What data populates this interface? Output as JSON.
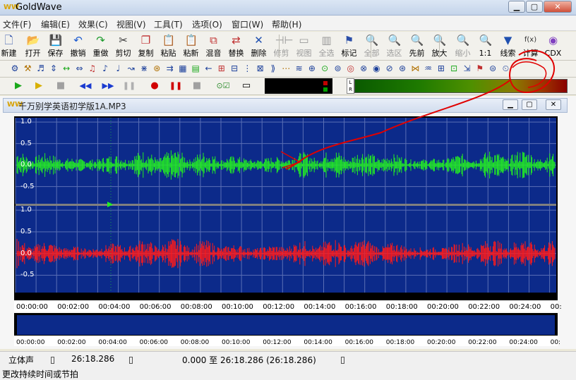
{
  "window": {
    "title": "GoldWave",
    "app_icon": "WW"
  },
  "menu": [
    "文件(F)",
    "编辑(E)",
    "效果(C)",
    "视图(V)",
    "工具(T)",
    "选项(O)",
    "窗口(W)",
    "帮助(H)"
  ],
  "toolbar1": [
    {
      "label": "新建",
      "icon": "new-file-icon",
      "glyph": "🗋",
      "color": "#2a4ea8",
      "enabled": true
    },
    {
      "label": "打开",
      "icon": "open-folder-icon",
      "glyph": "📂",
      "color": "#d9a000",
      "enabled": true
    },
    {
      "label": "保存",
      "icon": "save-icon",
      "glyph": "💾",
      "color": "#2050b0",
      "enabled": true
    },
    {
      "label": "撤销",
      "icon": "undo-icon",
      "glyph": "↶",
      "color": "#1a5ad0",
      "enabled": true
    },
    {
      "label": "重做",
      "icon": "redo-icon",
      "glyph": "↷",
      "color": "#1a9a2a",
      "enabled": true
    },
    {
      "label": "剪切",
      "icon": "cut-icon",
      "glyph": "✂",
      "color": "#333333",
      "enabled": true
    },
    {
      "label": "复制",
      "icon": "copy-icon",
      "glyph": "❐",
      "color": "#c03030",
      "enabled": true
    },
    {
      "label": "粘贴",
      "icon": "paste-icon",
      "glyph": "📋",
      "color": "#b07020",
      "enabled": true
    },
    {
      "label": "粘新",
      "icon": "paste-new-icon",
      "glyph": "📋",
      "color": "#b07020",
      "enabled": true
    },
    {
      "label": "混音",
      "icon": "mix-icon",
      "glyph": "⧉",
      "color": "#c03030",
      "enabled": true
    },
    {
      "label": "替换",
      "icon": "replace-icon",
      "glyph": "⇄",
      "color": "#c03030",
      "enabled": true
    },
    {
      "label": "删除",
      "icon": "delete-icon",
      "glyph": "✕",
      "color": "#2050b0",
      "enabled": true
    },
    {
      "label": "修剪",
      "icon": "trim-icon",
      "glyph": "⊣⊢",
      "color": "#999999",
      "enabled": false
    },
    {
      "label": "视图",
      "icon": "view-icon",
      "glyph": "▭",
      "color": "#999999",
      "enabled": false
    },
    {
      "label": "全选",
      "icon": "select-all-icon",
      "glyph": "▥",
      "color": "#999999",
      "enabled": false
    },
    {
      "label": "标记",
      "icon": "marker-icon",
      "glyph": "⚑",
      "color": "#2a4ea8",
      "enabled": true
    },
    {
      "label": "全部",
      "icon": "zoom-all-icon",
      "glyph": "🔍",
      "color": "#999999",
      "enabled": false
    },
    {
      "label": "选区",
      "icon": "zoom-selection-icon",
      "glyph": "🔍",
      "color": "#999999",
      "enabled": false
    },
    {
      "label": "先前",
      "icon": "zoom-previous-icon",
      "glyph": "🔍",
      "color": "#333333",
      "enabled": true
    },
    {
      "label": "放大",
      "icon": "zoom-in-icon",
      "glyph": "🔍",
      "color": "#333333",
      "enabled": true
    },
    {
      "label": "缩小",
      "icon": "zoom-out-icon",
      "glyph": "🔍",
      "color": "#999999",
      "enabled": false
    },
    {
      "label": "1:1",
      "icon": "zoom-1-1-icon",
      "glyph": "🔍",
      "color": "#333333",
      "enabled": true
    },
    {
      "label": "线索",
      "icon": "cue-icon",
      "glyph": "▼",
      "color": "#2050b0",
      "enabled": true
    },
    {
      "label": "计算",
      "icon": "calculator-icon",
      "glyph": "f(x)",
      "color": "#333333",
      "enabled": true
    },
    {
      "label": "CDX",
      "icon": "cd-extract-icon",
      "glyph": "◉",
      "color": "#8040c0",
      "enabled": true
    }
  ],
  "toolbar2_icons": [
    "effect-1-icon",
    "effect-2-icon",
    "effect-3-icon",
    "effect-4-icon",
    "effect-5-icon",
    "effect-6-icon",
    "effect-7-icon",
    "effect-8-icon",
    "effect-9-icon",
    "effect-10-icon",
    "effect-11-icon",
    "effect-12-icon",
    "effect-13-icon",
    "effect-14-icon",
    "effect-15-icon",
    "effect-16-icon",
    "effect-17-icon",
    "effect-18-icon",
    "effect-19-icon",
    "effect-20-icon",
    "effect-21-icon",
    "effect-22-icon",
    "effect-23-icon",
    "effect-24-icon",
    "effect-25-icon",
    "effect-26-icon",
    "effect-27-icon",
    "effect-28-icon",
    "effect-29-icon",
    "effect-30-icon",
    "effect-31-icon",
    "effect-32-icon",
    "effect-33-icon",
    "effect-34-icon",
    "effect-35-icon",
    "effect-36-icon",
    "effect-37-icon",
    "effect-38-icon",
    "time-warp-icon"
  ],
  "transport": [
    {
      "icon": "play-icon",
      "glyph": "▶",
      "color": "#1aa81a"
    },
    {
      "icon": "play-selection-icon",
      "glyph": "▶",
      "color": "#d8b000"
    },
    {
      "icon": "stop-icon",
      "glyph": "■",
      "color": "#a0a0a0"
    },
    {
      "icon": "rewind-icon",
      "glyph": "◀◀",
      "color": "#1a3ad0"
    },
    {
      "icon": "fast-forward-icon",
      "glyph": "▶▶",
      "color": "#1a3ad0"
    },
    {
      "icon": "pause-icon",
      "glyph": "❚❚",
      "color": "#b0b0b0"
    },
    {
      "icon": "record-icon",
      "glyph": "●",
      "color": "#d00000"
    },
    {
      "icon": "record-pause-icon",
      "glyph": "❚❚",
      "color": "#d00000"
    },
    {
      "icon": "record-stop-icon",
      "glyph": "■",
      "color": "#a0a0a0"
    },
    {
      "icon": "monitor-icon",
      "glyph": "⊙☑",
      "color": "#2a8a2a"
    },
    {
      "icon": "window-icon",
      "glyph": "▭",
      "color": "#000000"
    }
  ],
  "meter": {
    "label_l": "L",
    "label_r": "R"
  },
  "document": {
    "title": "千万别学英语初学版1A.MP3",
    "icon": "WW"
  },
  "waveform": {
    "y_ticks": [
      "1.0",
      "0.5",
      "0.0",
      "-0.5"
    ],
    "left_color": "#22ee22",
    "right_color": "#ff1a1a",
    "background": "#0c2a8a",
    "time_labels": [
      "00:00:00",
      "00:02:00",
      "00:04:00",
      "00:06:00",
      "00:08:00",
      "00:10:00",
      "00:12:00",
      "00:14:00",
      "00:16:00",
      "00:18:00",
      "00:20:00",
      "00:22:00",
      "00:24:00",
      "00:"
    ]
  },
  "overview": {
    "time_labels": [
      "00:00:00",
      "00:02:00",
      "00:04:00",
      "00:06:00",
      "00:08:00",
      "00:10:00",
      "00:12:00",
      "00:14:00",
      "00:16:00",
      "00:18:00",
      "00:20:00",
      "00:22:00",
      "00:24:00",
      "00:"
    ]
  },
  "status": {
    "channel": "立体声",
    "duration": "26:18.286",
    "selection": "0.000 至 26:18.286 (26:18.286)"
  },
  "hint": "更改持续时间或节拍",
  "annotation": {
    "color": "#e00000"
  }
}
